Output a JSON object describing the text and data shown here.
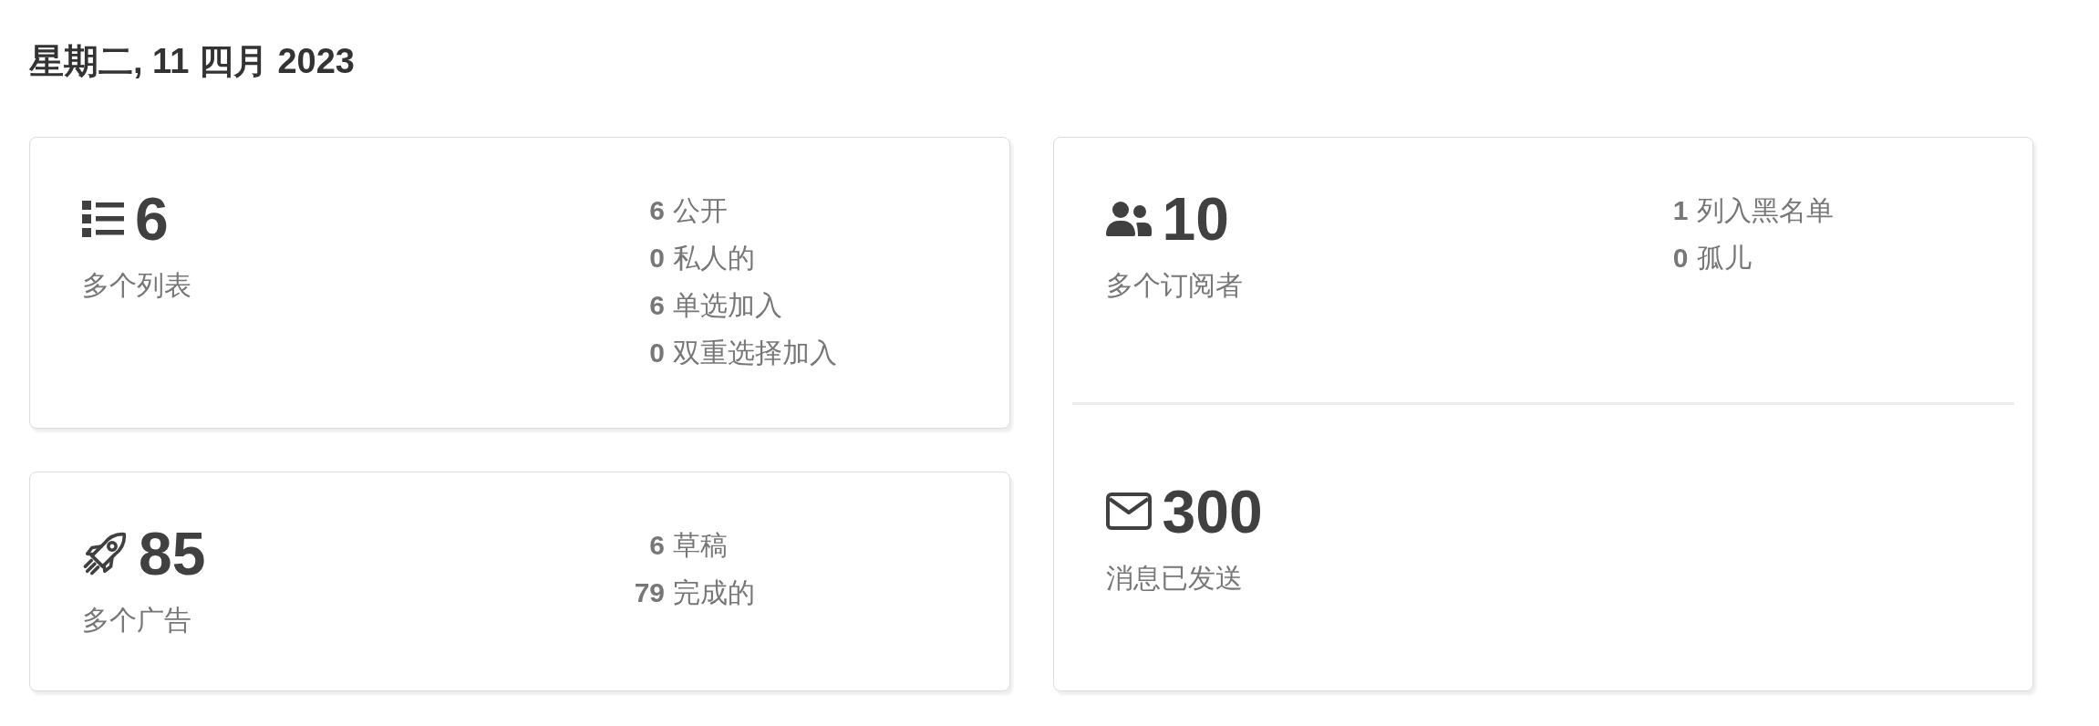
{
  "date_heading": "星期二, 11 四月 2023",
  "columns": [
    {
      "cards": [
        {
          "sections": [
            {
              "kind": "lists",
              "count": "6",
              "label": "多个列表",
              "stats": [
                {
                  "count": "6",
                  "name": "公开"
                },
                {
                  "count": "0",
                  "name": "私人的"
                },
                {
                  "count": "6",
                  "name": "单选加入"
                },
                {
                  "count": "0",
                  "name": "双重选择加入"
                }
              ]
            }
          ]
        },
        {
          "sections": [
            {
              "kind": "campaigns",
              "count": "85",
              "label": "多个广告",
              "stats": [
                {
                  "count": "6",
                  "name": "草稿"
                },
                {
                  "count": "79",
                  "name": "完成的"
                }
              ]
            }
          ]
        }
      ]
    },
    {
      "cards": [
        {
          "sections": [
            {
              "kind": "subscribers",
              "count": "10",
              "label": "多个订阅者",
              "stats": [
                {
                  "count": "1",
                  "name": "列入黑名单"
                },
                {
                  "count": "0",
                  "name": "孤儿"
                }
              ]
            },
            {
              "kind": "messages",
              "count": "300",
              "label": "消息已发送"
            }
          ]
        }
      ]
    }
  ]
}
